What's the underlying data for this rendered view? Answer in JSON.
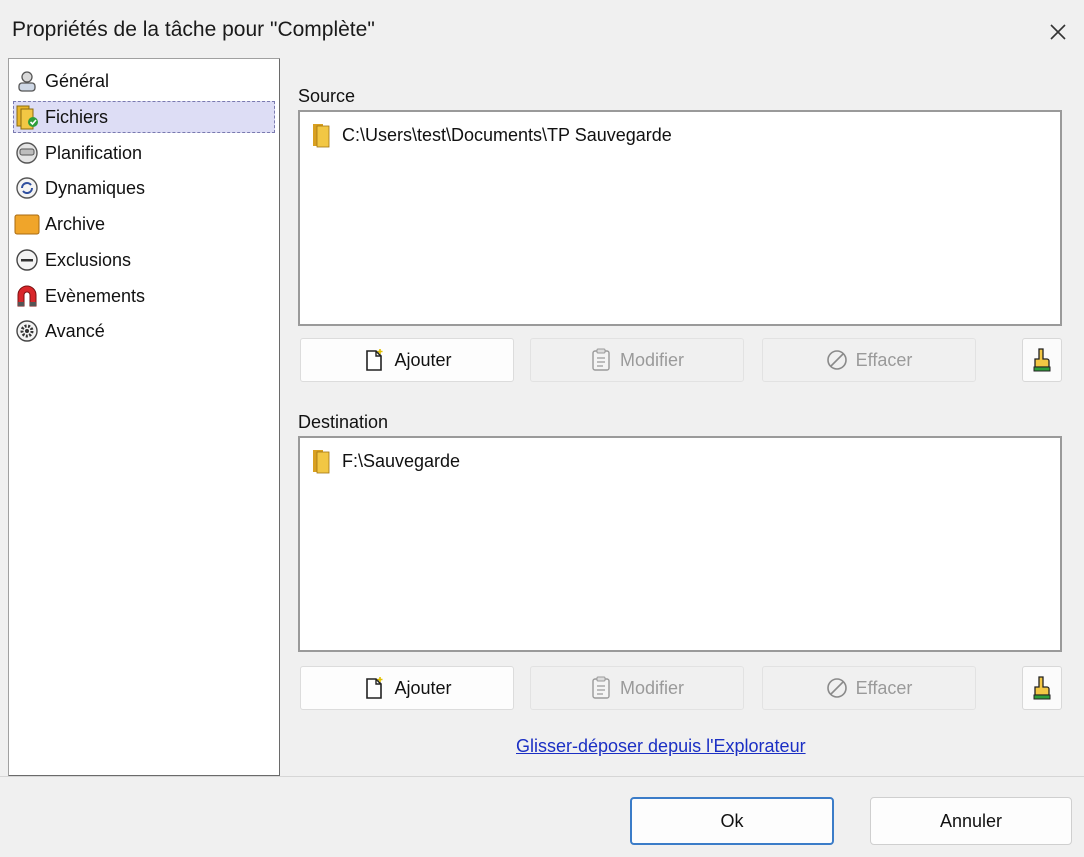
{
  "window": {
    "title": "Propriétés de la tâche pour \"Complète\""
  },
  "nav": {
    "items": [
      {
        "label": "Général",
        "icon": "user-settings-icon"
      },
      {
        "label": "Fichiers",
        "icon": "files-icon",
        "selected": true
      },
      {
        "label": "Planification",
        "icon": "clock-icon"
      },
      {
        "label": "Dynamiques",
        "icon": "refresh-icon"
      },
      {
        "label": "Archive",
        "icon": "archive-icon"
      },
      {
        "label": "Exclusions",
        "icon": "minus-circle-icon"
      },
      {
        "label": "Evènements",
        "icon": "magnet-icon"
      },
      {
        "label": "Avancé",
        "icon": "gear-icon"
      }
    ]
  },
  "source": {
    "label": "Source",
    "items": [
      "C:\\Users\\test\\Documents\\TP Sauvegarde"
    ],
    "buttons": {
      "add": "Ajouter",
      "modify": "Modifier",
      "clear": "Effacer"
    }
  },
  "destination": {
    "label": "Destination",
    "items": [
      "F:\\Sauvegarde"
    ],
    "buttons": {
      "add": "Ajouter",
      "modify": "Modifier",
      "clear": "Effacer"
    }
  },
  "link": {
    "text": "Glisser-déposer depuis l'Explorateur"
  },
  "footer": {
    "ok": "Ok",
    "cancel": "Annuler"
  },
  "colors": {
    "accent": "#3b7cc8",
    "link": "#1b2fc4",
    "selection": "#ddddf5"
  }
}
